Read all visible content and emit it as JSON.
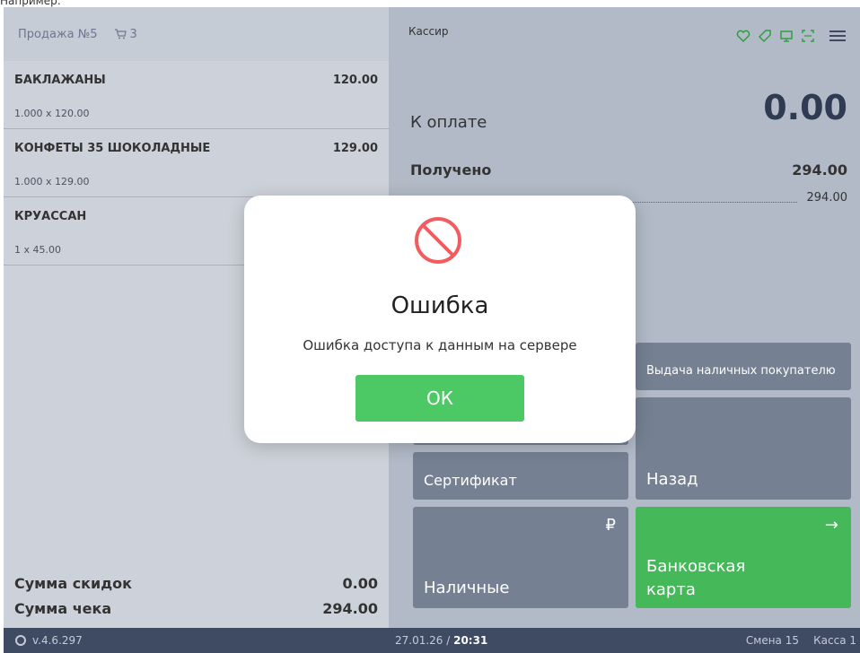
{
  "caption": "Например:",
  "sale": {
    "title": "Продажа №5",
    "cart_count": "3",
    "items": [
      {
        "name": "БАКЛАЖАНЫ",
        "total": "120.00",
        "qty": "1.000 x 120.00"
      },
      {
        "name": "КОНФЕТЫ 35 ШОКОЛАДНЫЕ",
        "total": "129.00",
        "qty": "1.000 x 129.00"
      },
      {
        "name": "КРУАССАН",
        "total": "",
        "qty": "1 x 45.00"
      }
    ],
    "discount_label": "Сумма скидок",
    "discount_value": "0.00",
    "check_label": "Сумма чека",
    "check_value": "294.00"
  },
  "payment": {
    "cashier": "Кассир",
    "to_pay_label": "К оплате",
    "to_pay_value": "0.00",
    "received_label": "Получено",
    "received_value": "294.00",
    "received_sub": "294.00",
    "buttons": {
      "cash_out": "Выдача наличных покупателю",
      "certificate": "Сертификат",
      "back": "Назад",
      "cash": "Наличные",
      "cash_symbol": "₽",
      "bank_card_line1": "Банковская",
      "bank_card_line2": "карта",
      "bank_card_arrow": "→"
    }
  },
  "footer": {
    "version": "v.4.6.297",
    "date": "27.01.26 / ",
    "time": "20:31",
    "shift": "Смена 15",
    "kassa": "Касса 1"
  },
  "modal": {
    "title": "Ошибка",
    "message": "Ошибка доступа к данным на сервере",
    "ok": "ОК"
  },
  "colors": {
    "accent_green": "#45b95a",
    "error_red": "#f25c60",
    "tile": "#758092",
    "footer": "#3f4a63"
  }
}
